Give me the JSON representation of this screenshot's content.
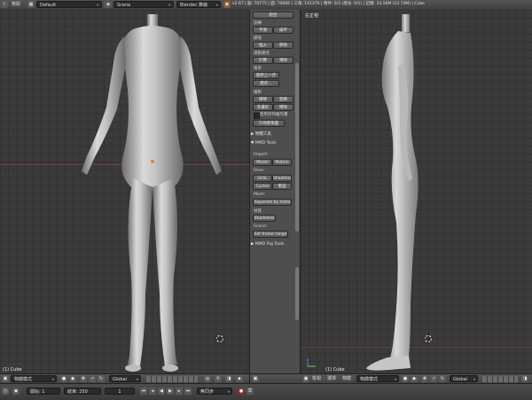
{
  "topbar": {
    "help_menu": "幫助",
    "screen_layout": "Default",
    "scene": "Scene",
    "render_engine": "Blender 算繪",
    "stats": "v2.67 | 點: 70775 | 面: 70669 | 三角: 141376 | 物件: 0/3 (燈光: 0/1) | 記憶: 33.56M (23.74M) | Cube"
  },
  "viewport_left": {
    "object_label": "(1) Cube"
  },
  "viewport_right": {
    "view_label": "右正視",
    "object_label": "(1) Cube"
  },
  "tool_panel": {
    "top_button": "組合",
    "sections": [
      {
        "title": "旋轉",
        "buttons": [
          "平滑",
          "扁平"
        ]
      },
      {
        "title": "鍵值",
        "buttons": [
          "插入",
          "移除"
        ]
      },
      {
        "title": "運動路徑",
        "buttons": [
          "計算",
          "清除"
        ]
      },
      {
        "title": "復原",
        "buttons": [
          "復原上一步",
          "歷史..."
        ]
      },
      {
        "title": "繪製",
        "buttons": [
          "線條",
          "直線",
          "多邊形",
          "擦除"
        ]
      }
    ],
    "use_sequence_checkbox": "使用序列繪作畫",
    "only_3d_button": "只地窗角面",
    "physics_tools_header": "物體工具",
    "mmd_tools_header": "MMD Tools",
    "import_label": "Import:",
    "import_buttons": [
      "Model",
      "Motion"
    ],
    "view_label": "View:",
    "view_buttons": [
      "GLSL",
      "Shadeles",
      "Cycles",
      "重設"
    ],
    "mesh_label": "Mesh:",
    "separate_button": "Separate by mate",
    "material_label": "材質",
    "shadeless_button": "Shadeless",
    "scene_label": "Scene:",
    "set_frame_button": "Set frame range",
    "rig_tools_header": "MMD Rig Tools"
  },
  "bottombar_left": {
    "mode": "物體模式",
    "orientation": "Global"
  },
  "bottombar_right": {
    "menus": [
      "檢視",
      "選擇",
      "物體"
    ],
    "mode": "物體模式",
    "orientation": "Global"
  },
  "timeline": {
    "start_label": "開始: 1",
    "end_label": "結束: 250",
    "current_frame": "1",
    "sync_mode": "無同步"
  }
}
